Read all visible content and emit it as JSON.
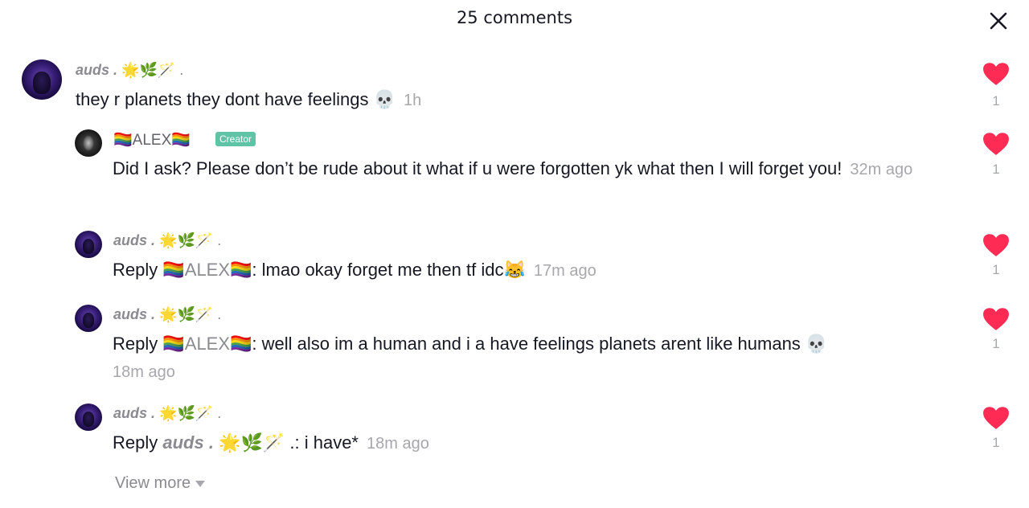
{
  "header": {
    "title": "25 comments"
  },
  "comments": [
    {
      "username": "auds .",
      "user_emoji": "🌟🌿🪄 .",
      "text": "they r planets they dont have feelings 💀",
      "time": "1h",
      "likes": "1"
    },
    {
      "username": "🏳️‍🌈ALEX🏳️‍🌈",
      "badge": "Creator",
      "text": "Did I ask? Please don’t be rude about it what if u were forgotten yk what then I will forget you!",
      "time": "32m ago",
      "likes": "1"
    },
    {
      "username": "auds .",
      "user_emoji": "🌟🌿🪄 .",
      "reply_prefix": "Reply",
      "mention": "🏳️‍🌈ALEX🏳️‍🌈",
      "text": ": lmao okay forget me then tf idc😹",
      "time": "17m ago",
      "likes": "1"
    },
    {
      "username": "auds .",
      "user_emoji": "🌟🌿🪄 .",
      "reply_prefix": "Reply",
      "mention": "🏳️‍🌈ALEX🏳️‍🌈",
      "text": ": well also im a human and i a have feelings planets arent like humans 💀",
      "time": "18m ago",
      "likes": "1"
    },
    {
      "username": "auds .",
      "user_emoji": "🌟🌿🪄 .",
      "reply_prefix": "Reply",
      "mention": "auds .",
      "mention_emoji": "🌟🌿🪄",
      "text": ".: i have*",
      "time": "18m ago",
      "likes": "1"
    }
  ],
  "view_more": "View more",
  "colors": {
    "heart": "#fe2c55",
    "creator_badge": "#5fc3a5"
  },
  "icons": {
    "close": "close-icon",
    "like": "heart-icon",
    "expand": "chevron-down-icon"
  }
}
